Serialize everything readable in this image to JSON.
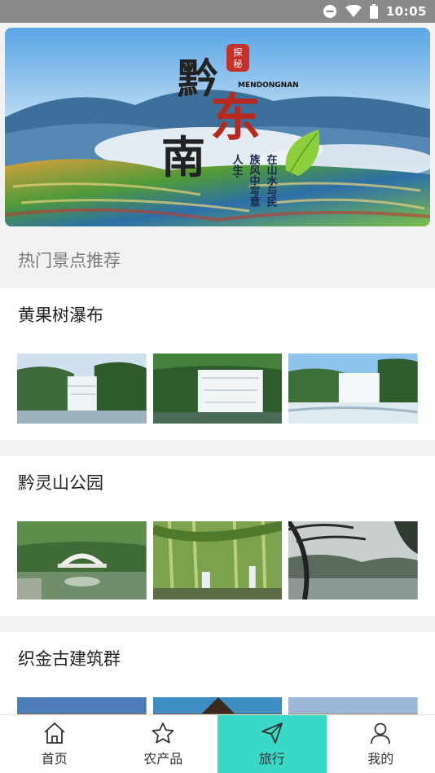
{
  "status_bar": {
    "time": "10:05",
    "icons": [
      "do-not-disturb-icon",
      "wifi-icon",
      "battery-icon"
    ]
  },
  "banner": {
    "title_chars": [
      "黔",
      "东",
      "南"
    ],
    "seal": "探秘",
    "subtitle_en": "MENDONGNAN",
    "slogan_lines": [
      "在山水与民",
      "族风中写意",
      "人生·"
    ]
  },
  "section_title": "热门景点推荐",
  "spots": [
    {
      "name": "黄果树瀑布",
      "photos": [
        "waterfall-photo",
        "waterfall-photo",
        "waterfall-photo"
      ]
    },
    {
      "name": "黔灵山公园",
      "photos": [
        "bridge-photo",
        "bamboo-photo",
        "lake-photo"
      ]
    },
    {
      "name": "织金古建筑群",
      "photos": [
        "building-photo",
        "building-photo",
        "building-photo"
      ]
    }
  ],
  "tabs": [
    {
      "label": "首页",
      "icon": "home-icon",
      "active": false
    },
    {
      "label": "农产品",
      "icon": "star-icon",
      "active": false
    },
    {
      "label": "旅行",
      "icon": "paper-plane-icon",
      "active": true
    },
    {
      "label": "我的",
      "icon": "user-icon",
      "active": false
    }
  ],
  "colors": {
    "active_tab": "#3ad8c6",
    "status_bar": "#8a8a8a",
    "background": "#f2f2f2"
  }
}
